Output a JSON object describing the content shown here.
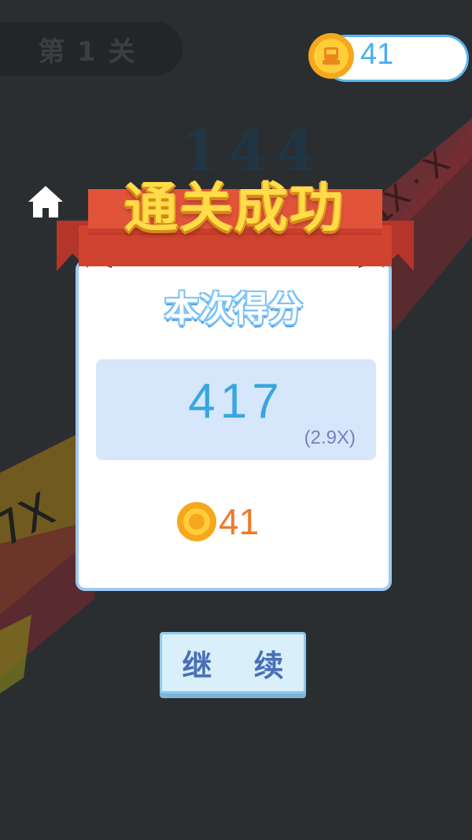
{
  "level": {
    "label": "第 1 关"
  },
  "coins": {
    "balance": "41"
  },
  "background": {
    "faded_number": "144"
  },
  "dialog": {
    "title": "通关成功",
    "subtitle": "本次得分",
    "score": "417",
    "multiplier": "(2.9X)",
    "reward_coins": "41"
  },
  "buttons": {
    "continue_label": "继 续"
  },
  "icons": {
    "home": "home-icon",
    "coin": "coin-icon"
  },
  "colors": {
    "background": "#2b2e30",
    "ribbon": "#d0432e",
    "title_text": "#ffdc48",
    "score_text": "#38a6e0",
    "reward_text": "#ef7a2c",
    "accent_blue": "#5bb6f0"
  }
}
